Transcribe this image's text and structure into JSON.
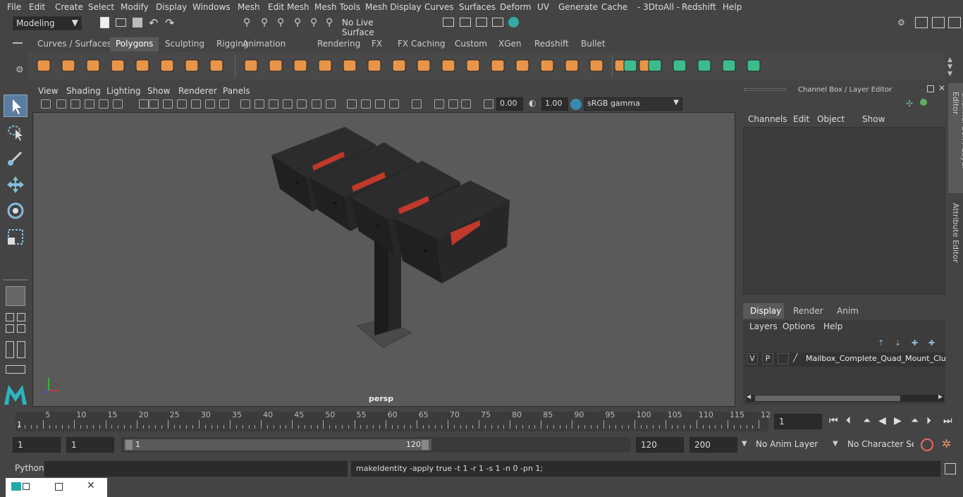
{
  "menubar": {
    "items": [
      "File",
      "Edit",
      "Create",
      "Select",
      "Modify",
      "Display",
      "Windows",
      "Mesh",
      "Edit Mesh",
      "Mesh Tools",
      "Mesh Display",
      "Curves",
      "Surfaces",
      "Deform",
      "UV",
      "Generate",
      "Cache",
      "- 3DtoAll -",
      "Redshift",
      "Help"
    ]
  },
  "status": {
    "mode": "Modeling",
    "live_surface": "No Live Surface"
  },
  "shelf": {
    "tabs": [
      "Curves / Surfaces",
      "Polygons",
      "Sculpting",
      "Rigging",
      "Animation",
      "Rendering",
      "FX",
      "FX Caching",
      "Custom",
      "XGen",
      "Redshift",
      "Bullet"
    ],
    "active_tab": "Polygons"
  },
  "viewport": {
    "menus": [
      "View",
      "Shading",
      "Lighting",
      "Show",
      "Renderer",
      "Panels"
    ],
    "exposure": "0.00",
    "gamma": "1.00",
    "colorspace": "sRGB gamma",
    "camera_label": "persp"
  },
  "channelbox": {
    "title": "Channel Box / Layer Editor",
    "menus": [
      "Channels",
      "Edit",
      "Object",
      "Show"
    ],
    "layer_tabs": [
      "Display",
      "Render",
      "Anim"
    ],
    "active_layer_tab": "Display",
    "layer_menus": [
      "Layers",
      "Options",
      "Help"
    ],
    "layer": {
      "v": "V",
      "p": "P",
      "name": "Mailbox_Complete_Quad_Mount_Clus"
    },
    "side_tabs": [
      "Channel Box / Layer Editor",
      "Attribute Editor"
    ]
  },
  "timeline": {
    "ticks": [
      "5",
      "10",
      "15",
      "20",
      "25",
      "30",
      "35",
      "40",
      "45",
      "50",
      "55",
      "60",
      "65",
      "70",
      "75",
      "80",
      "85",
      "90",
      "95",
      "100",
      "105",
      "110",
      "115",
      "12"
    ],
    "start_label": "1",
    "current_frame": "1"
  },
  "range": {
    "start": "1",
    "start2": "1",
    "slider_start": "1",
    "slider_end": "120",
    "end": "120",
    "end2": "200",
    "anim_layer": "No Anim Layer",
    "char_set": "No Character Set"
  },
  "cmd": {
    "lang": "Python",
    "output": "makeIdentity -apply true -t 1 -r 1 -s 1 -n 0 -pn 1;"
  }
}
